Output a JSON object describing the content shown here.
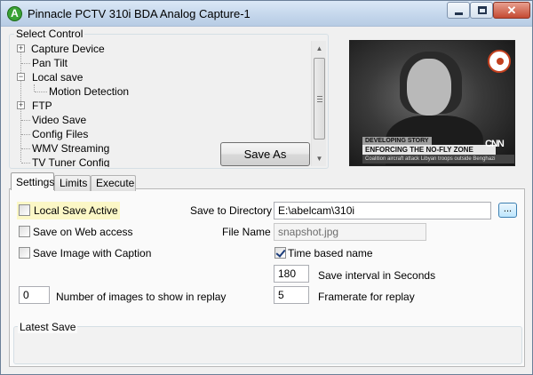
{
  "window": {
    "title": "Pinnacle PCTV 310i BDA Analog Capture-1",
    "app_icon_letter": "A",
    "close_glyph": "✕"
  },
  "select_control": {
    "legend": "Select Control",
    "tree": [
      {
        "label": "Capture Device",
        "level": 0,
        "expander": "+"
      },
      {
        "label": "Pan Tilt",
        "level": 0,
        "expander": ""
      },
      {
        "label": "Local save",
        "level": 0,
        "expander": "−"
      },
      {
        "label": "Motion Detection",
        "level": 1,
        "expander": ""
      },
      {
        "label": "FTP",
        "level": 0,
        "expander": "+"
      },
      {
        "label": "Video Save",
        "level": 0,
        "expander": ""
      },
      {
        "label": "Config Files",
        "level": 0,
        "expander": ""
      },
      {
        "label": "WMV Streaming",
        "level": 0,
        "expander": ""
      },
      {
        "label": "TV Tuner Config",
        "level": 0,
        "expander": ""
      }
    ],
    "save_as_label": "Save As"
  },
  "preview": {
    "caption_top": "DEVELOPING STORY",
    "caption_main": "ENFORCING THE NO-FLY ZONE",
    "caption_sub": "Coalition aircraft attack Libyan troops outside Benghazi",
    "network": "CNN"
  },
  "tabs": [
    {
      "label": "Settings",
      "active": true
    },
    {
      "label": "Limits",
      "active": false
    },
    {
      "label": "Execute",
      "active": false
    }
  ],
  "settings": {
    "local_save_active": {
      "label": "Local Save Active",
      "checked": false
    },
    "save_on_web_access": {
      "label": "Save on Web access",
      "checked": false
    },
    "save_image_with_caption": {
      "label": "Save Image with Caption",
      "checked": false
    },
    "replay_count": {
      "value": "0",
      "label": "Number of images to show in replay"
    },
    "save_to_directory": {
      "label": "Save to Directory",
      "value": "E:\\abelcam\\310i",
      "browse_label": "..."
    },
    "file_name": {
      "label": "File Name",
      "value": "snapshot.jpg"
    },
    "time_based_name": {
      "label": "Time based name",
      "checked": true
    },
    "save_interval": {
      "value": "180",
      "label": "Save interval in Seconds"
    },
    "framerate": {
      "value": "5",
      "label": "Framerate for replay"
    },
    "latest_save_legend": "Latest Save"
  }
}
